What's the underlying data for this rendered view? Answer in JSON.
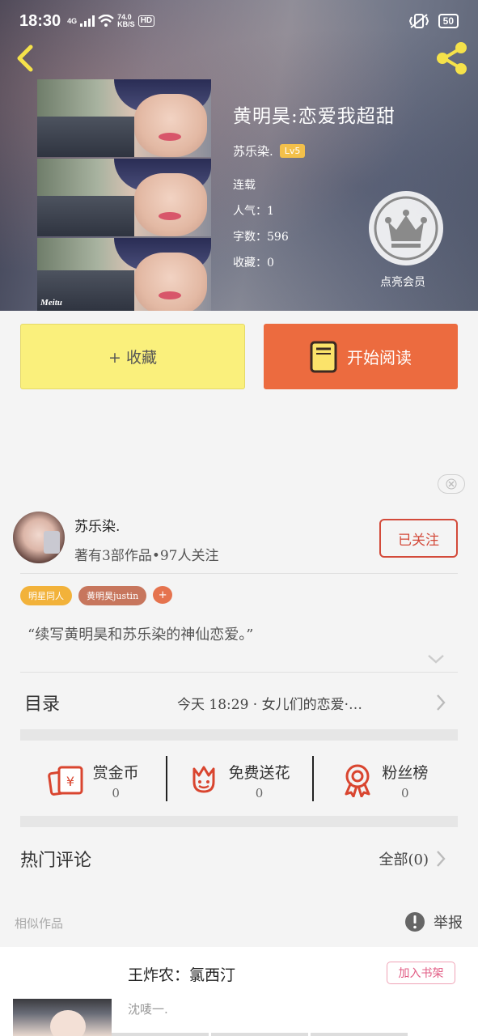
{
  "status_bar": {
    "time": "18:30",
    "network": "4G",
    "speed_value": "74.0",
    "speed_unit": "KB/S",
    "hd": "HD",
    "battery": "50"
  },
  "book": {
    "title": "黄明昊:恋爱我超甜",
    "author": "苏乐染.",
    "level": "Lv5",
    "status": "连载",
    "popularity": "人气：1",
    "word_count": "字数：596",
    "favorites": "收藏：0",
    "cover_watermark": "Meitu",
    "vip_label": "点亮会员"
  },
  "actions": {
    "collect": "+ 收藏",
    "read": "开始阅读"
  },
  "author_card": {
    "name": "苏乐染.",
    "subtitle": "著有3部作品•97人关注",
    "follow": "已关注",
    "tags": [
      {
        "label": "明星同人",
        "color": "#f2b23a"
      },
      {
        "label": "黄明昊justin",
        "color": "#c7765d"
      }
    ],
    "tag_add": "+",
    "intro": "“续写黄明昊和苏乐染的神仙恋爱。”"
  },
  "toc": {
    "label": "目录",
    "latest": "今天 18:29 · 女儿们的恋爱·…"
  },
  "rewards": [
    {
      "title": "赏金币",
      "value": "0",
      "icon": "gold-coin-icon"
    },
    {
      "title": "免费送花",
      "value": "0",
      "icon": "flower-icon"
    },
    {
      "title": "粉丝榜",
      "value": "0",
      "icon": "ribbon-medal-icon"
    }
  ],
  "comments": {
    "label": "热门评论",
    "all": "全部(0)"
  },
  "similar": {
    "label": "相似作品",
    "report": "举报"
  },
  "recommendation": {
    "title": "王炸农：氯西汀",
    "author": "沈唛一.",
    "add": "加入书架"
  },
  "colors": {
    "accent_orange": "#ec6b3f",
    "collect_yellow": "#faf07c",
    "follow_red": "#d34a3a",
    "level_gold": "#f3c04a"
  }
}
